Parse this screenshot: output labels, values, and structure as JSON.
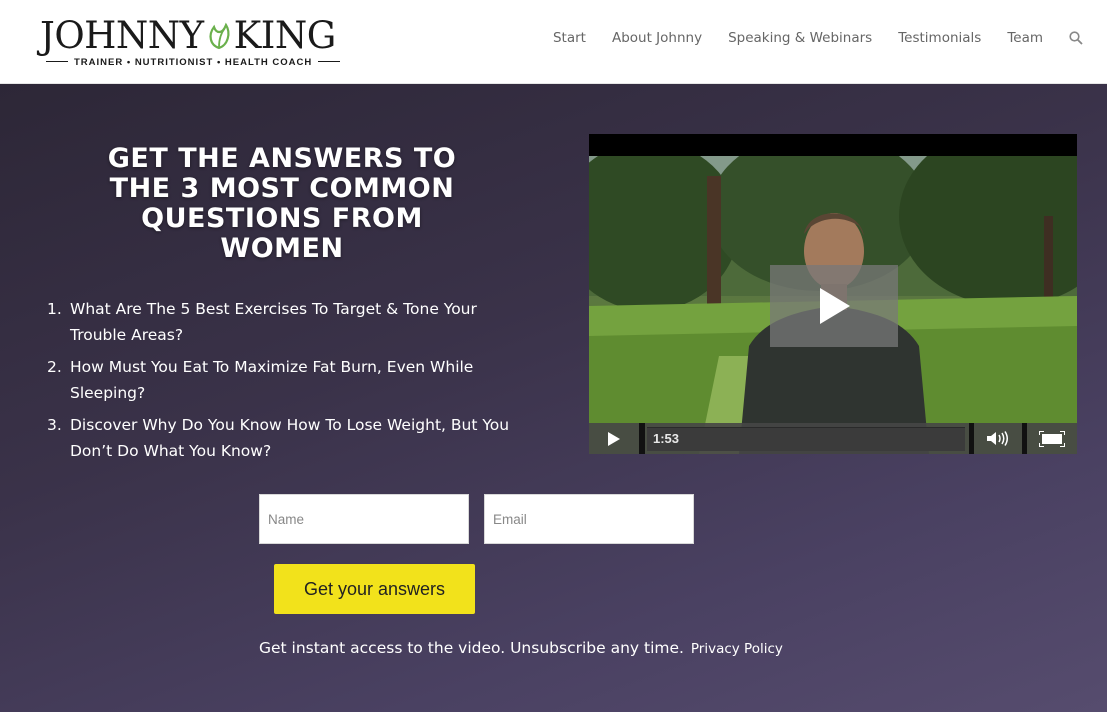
{
  "header": {
    "logo": {
      "name_left": "JOHNNY",
      "name_right": "KING",
      "tagline": "TRAINER • NUTRITIONIST • HEALTH COACH",
      "leaf_color": "#6ab04c"
    },
    "nav": [
      {
        "label": "Start"
      },
      {
        "label": "About Johnny"
      },
      {
        "label": "Speaking & Webinars"
      },
      {
        "label": "Testimonials"
      },
      {
        "label": "Team"
      }
    ],
    "search_icon": "search-icon"
  },
  "hero": {
    "headline": "GET THE ANSWERS TO THE 3 MOST COMMON QUESTIONS FROM WOMEN",
    "questions": [
      {
        "num": "1.",
        "text": "What Are The 5 Best Exercises To Target & Tone Your Trouble Areas?"
      },
      {
        "num": "2.",
        "text": "How Must You Eat To Maximize Fat Burn, Even While Sleeping?"
      },
      {
        "num": "3.",
        "text": "Discover Why Do You Know How To Lose Weight, But You Don’t Do What You Know?"
      }
    ]
  },
  "video": {
    "time": "1:53",
    "progress": 0.0,
    "icons": [
      "play-icon",
      "volume-icon",
      "fullscreen-icon"
    ]
  },
  "form": {
    "name_placeholder": "Name",
    "email_placeholder": "Email",
    "submit_label": "Get your answers",
    "footnote": "Get instant access to the video. Unsubscribe any time.",
    "privacy_label": "Privacy Policy"
  },
  "colors": {
    "accent_yellow": "#f2e21b",
    "hero_bg": "#3a3249",
    "nav_text": "#666666"
  }
}
